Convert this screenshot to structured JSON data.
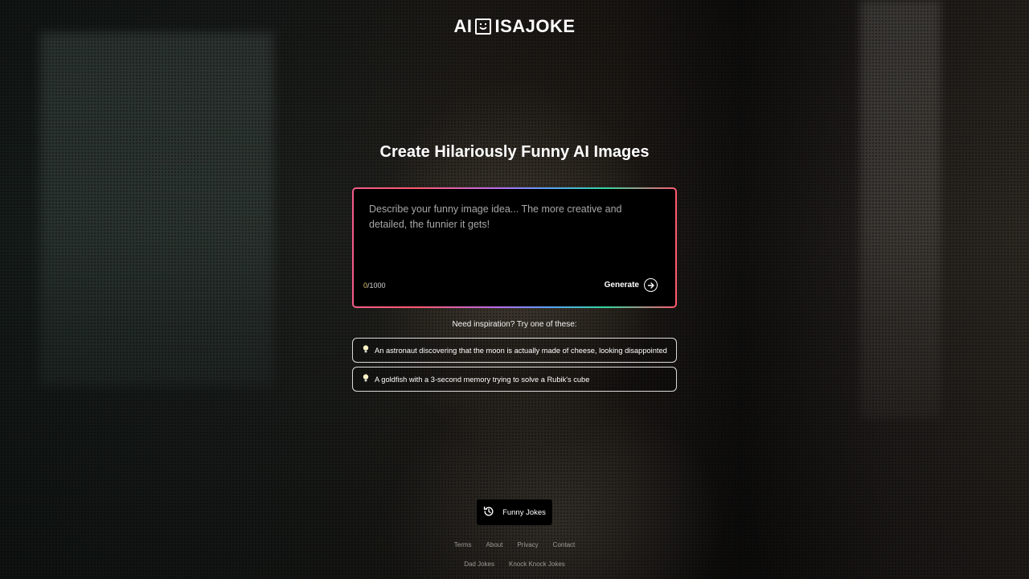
{
  "logo": {
    "left_text": "AI",
    "right_text": "ISAJOKE",
    "icon": "smiley-face-icon"
  },
  "headline": "Create Hilariously Funny AI Images",
  "prompt": {
    "placeholder": "Describe your funny image idea... The more creative and detailed, the funnier it gets!",
    "value": "",
    "counter_current": "0",
    "counter_max": "/1000",
    "generate_label": "Generate"
  },
  "inspiration": {
    "label": "Need inspiration? Try one of these:",
    "suggestions": [
      {
        "text": "An astronaut discovering that the moon is actually made of cheese, looking disappointed",
        "icon": "lightbulb-icon"
      },
      {
        "text": "A goldfish with a 3-second memory trying to solve a Rubik's cube",
        "icon": "lightbulb-icon"
      }
    ]
  },
  "jokes_button": {
    "label": "Funny Jokes",
    "icon": "history-icon"
  },
  "footer": {
    "row1": [
      "Terms",
      "About",
      "Privacy",
      "Contact"
    ],
    "row2": [
      "Dad Jokes",
      "Knock Knock Jokes"
    ]
  },
  "colors": {
    "accent_counter": "#e2c86a",
    "border_gradient": [
      "#f25c8a",
      "#ff5a6f",
      "#b86cf0",
      "#5aa0ff",
      "#33d6a0"
    ]
  }
}
